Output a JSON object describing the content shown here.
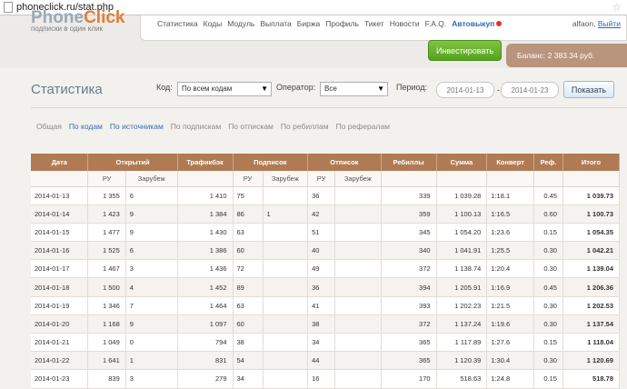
{
  "browser": {
    "url": "phoneclick.ru/stat.php"
  },
  "header": {
    "logo_main": "Phone",
    "logo_accent": "Click",
    "tagline": "подписки в один клик",
    "nav": [
      "Статистика",
      "Коды",
      "Модуль",
      "Выплата",
      "Биржа",
      "Профиль",
      "Тикет",
      "Новости",
      "F.A.Q."
    ],
    "autopay": "Автовыкуп",
    "user": "alfaon,",
    "logout": "Выйти",
    "invest_label": "Инвестировать",
    "balance": "Баланс: 2 383.34 руб."
  },
  "page": {
    "title": "Статистика",
    "code_label": "Код:",
    "code_value": "По всем кодам",
    "operator_label": "Оператор:",
    "operator_value": "Все",
    "period_label": "Период:",
    "date_from": "2014-01-13",
    "date_sep": "-",
    "date_to": "2014-01-23",
    "show_label": "Показать"
  },
  "subtabs": [
    {
      "label": "Общая",
      "link": false
    },
    {
      "label": "По кодам",
      "link": true
    },
    {
      "label": "По источникам",
      "link": true
    },
    {
      "label": "По подпискам",
      "link": false
    },
    {
      "label": "По отпискам",
      "link": false
    },
    {
      "label": "По ребиллам",
      "link": false
    },
    {
      "label": "По рефералам",
      "link": false
    }
  ],
  "table": {
    "headers": [
      "Дата",
      "Открытий",
      "Трафикбэк",
      "Подписок",
      "Отписок",
      "Ребиллы",
      "Сумма",
      "Конверт",
      "Реф.",
      "Итого"
    ],
    "subheaders": [
      "РУ",
      "Зарубеж",
      "РУ",
      "Зарубеж",
      "РУ",
      "Зарубеж"
    ],
    "rows": [
      [
        "2014-01-13",
        "1 355",
        "6",
        "1 410",
        "75",
        "",
        "36",
        "",
        "339",
        "1 039.28",
        "1:18.1",
        "0.45",
        "1 039.73"
      ],
      [
        "2014-01-14",
        "1 423",
        "9",
        "1 384",
        "86",
        "1",
        "42",
        "",
        "359",
        "1 100.13",
        "1:16.5",
        "0.60",
        "1 100.73"
      ],
      [
        "2014-01-15",
        "1 477",
        "9",
        "1 430",
        "63",
        "",
        "51",
        "",
        "345",
        "1 054.20",
        "1:23.6",
        "0.15",
        "1 054.35"
      ],
      [
        "2014-01-16",
        "1 525",
        "6",
        "1 386",
        "60",
        "",
        "40",
        "",
        "340",
        "1 041.91",
        "1:25.5",
        "0.30",
        "1 042.21"
      ],
      [
        "2014-01-17",
        "1 467",
        "3",
        "1 436",
        "72",
        "",
        "49",
        "",
        "372",
        "1 138.74",
        "1:20.4",
        "0.30",
        "1 139.04"
      ],
      [
        "2014-01-18",
        "1 500",
        "4",
        "1 452",
        "89",
        "",
        "36",
        "",
        "394",
        "1 205.91",
        "1:16.9",
        "0.45",
        "1 206.36"
      ],
      [
        "2014-01-19",
        "1 346",
        "7",
        "1 464",
        "63",
        "",
        "41",
        "",
        "393",
        "1 202.23",
        "1:21.5",
        "0.30",
        "1 202.53"
      ],
      [
        "2014-01-20",
        "1 168",
        "9",
        "1 097",
        "60",
        "",
        "38",
        "",
        "372",
        "1 137.24",
        "1:19.6",
        "0.30",
        "1 137.54"
      ],
      [
        "2014-01-21",
        "1 049",
        "0",
        "794",
        "38",
        "",
        "34",
        "",
        "365",
        "1 117.89",
        "1:27.6",
        "0.15",
        "1 118.04"
      ],
      [
        "2014-01-22",
        "1 641",
        "1",
        "831",
        "54",
        "",
        "44",
        "",
        "365",
        "1 120.39",
        "1:30.4",
        "0.30",
        "1 120.69"
      ],
      [
        "2014-01-23",
        "839",
        "3",
        "279",
        "34",
        "",
        "16",
        "",
        "170",
        "518.63",
        "1:24.8",
        "0.15",
        "518.78"
      ]
    ]
  }
}
